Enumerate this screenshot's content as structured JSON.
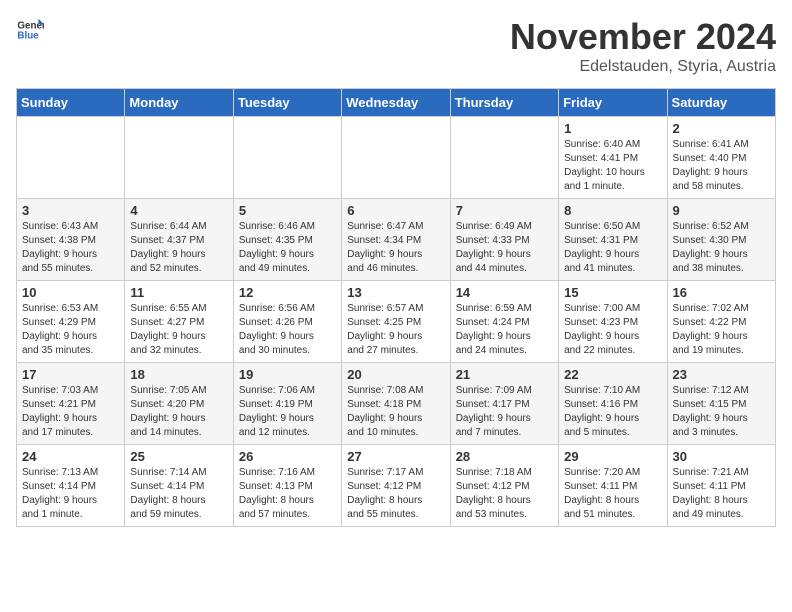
{
  "logo": {
    "line1": "General",
    "line2": "Blue"
  },
  "title": "November 2024",
  "location": "Edelstauden, Styria, Austria",
  "weekdays": [
    "Sunday",
    "Monday",
    "Tuesday",
    "Wednesday",
    "Thursday",
    "Friday",
    "Saturday"
  ],
  "weeks": [
    [
      {
        "day": "",
        "info": ""
      },
      {
        "day": "",
        "info": ""
      },
      {
        "day": "",
        "info": ""
      },
      {
        "day": "",
        "info": ""
      },
      {
        "day": "",
        "info": ""
      },
      {
        "day": "1",
        "info": "Sunrise: 6:40 AM\nSunset: 4:41 PM\nDaylight: 10 hours\nand 1 minute."
      },
      {
        "day": "2",
        "info": "Sunrise: 6:41 AM\nSunset: 4:40 PM\nDaylight: 9 hours\nand 58 minutes."
      }
    ],
    [
      {
        "day": "3",
        "info": "Sunrise: 6:43 AM\nSunset: 4:38 PM\nDaylight: 9 hours\nand 55 minutes."
      },
      {
        "day": "4",
        "info": "Sunrise: 6:44 AM\nSunset: 4:37 PM\nDaylight: 9 hours\nand 52 minutes."
      },
      {
        "day": "5",
        "info": "Sunrise: 6:46 AM\nSunset: 4:35 PM\nDaylight: 9 hours\nand 49 minutes."
      },
      {
        "day": "6",
        "info": "Sunrise: 6:47 AM\nSunset: 4:34 PM\nDaylight: 9 hours\nand 46 minutes."
      },
      {
        "day": "7",
        "info": "Sunrise: 6:49 AM\nSunset: 4:33 PM\nDaylight: 9 hours\nand 44 minutes."
      },
      {
        "day": "8",
        "info": "Sunrise: 6:50 AM\nSunset: 4:31 PM\nDaylight: 9 hours\nand 41 minutes."
      },
      {
        "day": "9",
        "info": "Sunrise: 6:52 AM\nSunset: 4:30 PM\nDaylight: 9 hours\nand 38 minutes."
      }
    ],
    [
      {
        "day": "10",
        "info": "Sunrise: 6:53 AM\nSunset: 4:29 PM\nDaylight: 9 hours\nand 35 minutes."
      },
      {
        "day": "11",
        "info": "Sunrise: 6:55 AM\nSunset: 4:27 PM\nDaylight: 9 hours\nand 32 minutes."
      },
      {
        "day": "12",
        "info": "Sunrise: 6:56 AM\nSunset: 4:26 PM\nDaylight: 9 hours\nand 30 minutes."
      },
      {
        "day": "13",
        "info": "Sunrise: 6:57 AM\nSunset: 4:25 PM\nDaylight: 9 hours\nand 27 minutes."
      },
      {
        "day": "14",
        "info": "Sunrise: 6:59 AM\nSunset: 4:24 PM\nDaylight: 9 hours\nand 24 minutes."
      },
      {
        "day": "15",
        "info": "Sunrise: 7:00 AM\nSunset: 4:23 PM\nDaylight: 9 hours\nand 22 minutes."
      },
      {
        "day": "16",
        "info": "Sunrise: 7:02 AM\nSunset: 4:22 PM\nDaylight: 9 hours\nand 19 minutes."
      }
    ],
    [
      {
        "day": "17",
        "info": "Sunrise: 7:03 AM\nSunset: 4:21 PM\nDaylight: 9 hours\nand 17 minutes."
      },
      {
        "day": "18",
        "info": "Sunrise: 7:05 AM\nSunset: 4:20 PM\nDaylight: 9 hours\nand 14 minutes."
      },
      {
        "day": "19",
        "info": "Sunrise: 7:06 AM\nSunset: 4:19 PM\nDaylight: 9 hours\nand 12 minutes."
      },
      {
        "day": "20",
        "info": "Sunrise: 7:08 AM\nSunset: 4:18 PM\nDaylight: 9 hours\nand 10 minutes."
      },
      {
        "day": "21",
        "info": "Sunrise: 7:09 AM\nSunset: 4:17 PM\nDaylight: 9 hours\nand 7 minutes."
      },
      {
        "day": "22",
        "info": "Sunrise: 7:10 AM\nSunset: 4:16 PM\nDaylight: 9 hours\nand 5 minutes."
      },
      {
        "day": "23",
        "info": "Sunrise: 7:12 AM\nSunset: 4:15 PM\nDaylight: 9 hours\nand 3 minutes."
      }
    ],
    [
      {
        "day": "24",
        "info": "Sunrise: 7:13 AM\nSunset: 4:14 PM\nDaylight: 9 hours\nand 1 minute."
      },
      {
        "day": "25",
        "info": "Sunrise: 7:14 AM\nSunset: 4:14 PM\nDaylight: 8 hours\nand 59 minutes."
      },
      {
        "day": "26",
        "info": "Sunrise: 7:16 AM\nSunset: 4:13 PM\nDaylight: 8 hours\nand 57 minutes."
      },
      {
        "day": "27",
        "info": "Sunrise: 7:17 AM\nSunset: 4:12 PM\nDaylight: 8 hours\nand 55 minutes."
      },
      {
        "day": "28",
        "info": "Sunrise: 7:18 AM\nSunset: 4:12 PM\nDaylight: 8 hours\nand 53 minutes."
      },
      {
        "day": "29",
        "info": "Sunrise: 7:20 AM\nSunset: 4:11 PM\nDaylight: 8 hours\nand 51 minutes."
      },
      {
        "day": "30",
        "info": "Sunrise: 7:21 AM\nSunset: 4:11 PM\nDaylight: 8 hours\nand 49 minutes."
      }
    ]
  ]
}
